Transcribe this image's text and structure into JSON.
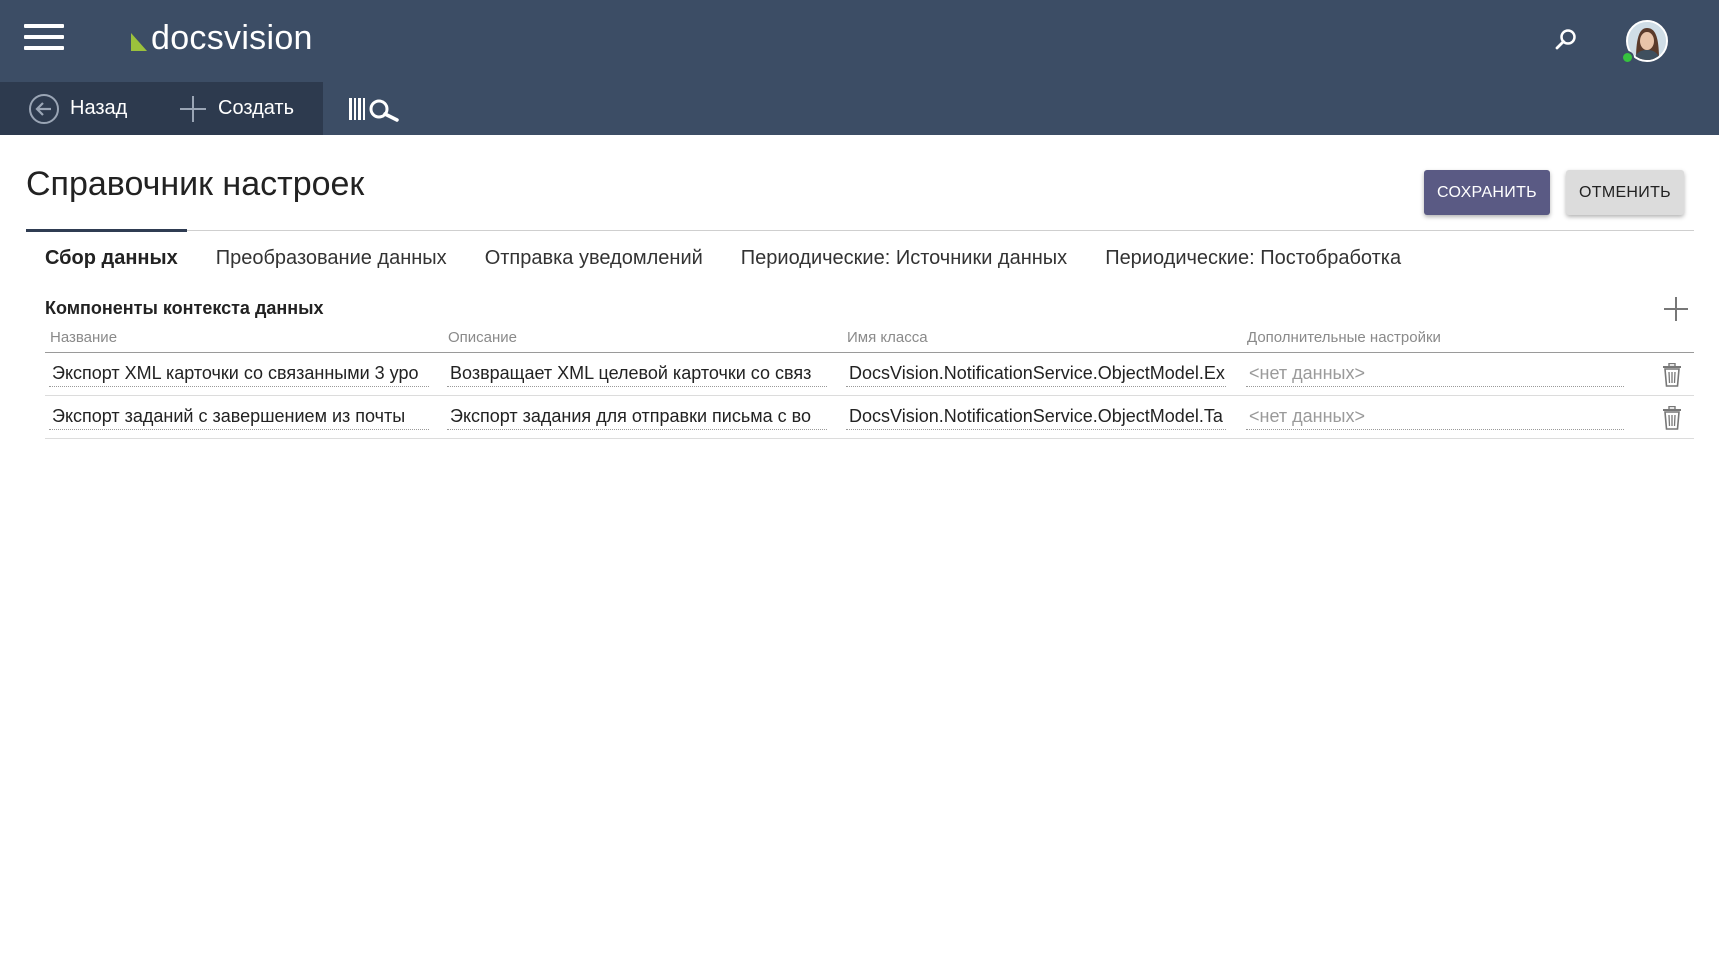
{
  "header": {
    "logo_text": "docsvision",
    "menu_icon": "hamburger-icon",
    "search_icon": "search-icon",
    "status_color": "#36c33e"
  },
  "toolbar": {
    "back_label": "Назад",
    "create_label": "Создать",
    "scan_icon": "barcode-search-icon"
  },
  "page": {
    "title": "Справочник настроек",
    "save_label": "СОХРАНИТЬ",
    "cancel_label": "ОТМЕНИТЬ"
  },
  "tabs": [
    {
      "label": "Сбор данных",
      "active": true
    },
    {
      "label": "Преобразование данных",
      "active": false
    },
    {
      "label": "Отправка уведомлений",
      "active": false
    },
    {
      "label": "Периодические: Источники данных",
      "active": false
    },
    {
      "label": "Периодические: Постобработка",
      "active": false
    }
  ],
  "section": {
    "title": "Компоненты контекста данных",
    "columns": [
      "Название",
      "Описание",
      "Имя класса",
      "Дополнительные настройки"
    ],
    "rows": [
      {
        "name": "Экспорт XML карточки со связанными 3 уро",
        "description": "Возвращает XML целевой карточки со связ",
        "class_name": "DocsVision.NotificationService.ObjectModel.Ex",
        "settings": "<нет данных>"
      },
      {
        "name": "Экспорт заданий с завершением из почты",
        "description": "Экспорт задания для отправки письма с во",
        "class_name": "DocsVision.NotificationService.ObjectModel.Ta",
        "settings": "<нет данных>"
      }
    ]
  },
  "colors": {
    "header_bg": "#3c4d65",
    "toolbar_dark": "#2d3a4e",
    "save_button": "#5a5a84",
    "cancel_button": "#dcdcdc",
    "logo_accent": "#9bc13c"
  }
}
